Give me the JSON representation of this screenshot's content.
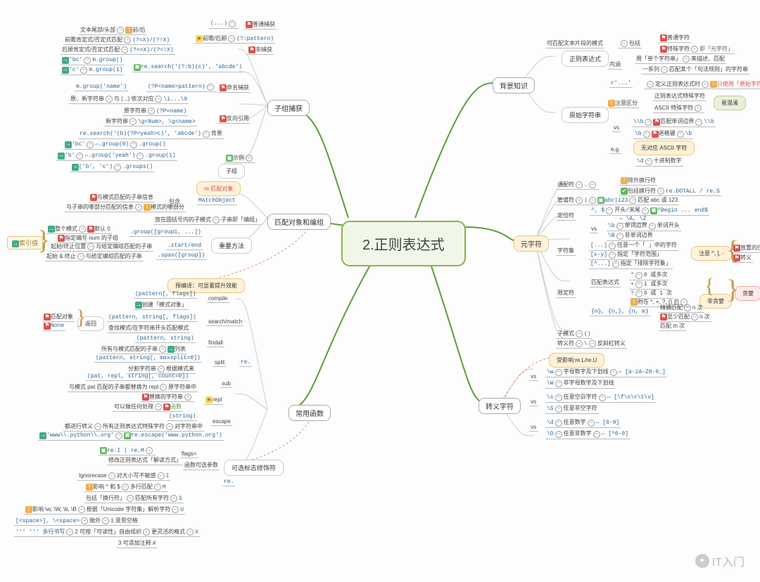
{
  "root": "2.正则表达式",
  "watermark": "IT入门",
  "branches": {
    "bg": "背景知识",
    "meta": "元字符",
    "escape": "转义字符",
    "func": "常用函数",
    "match": "匹配对象和编组",
    "group": "子组捕获"
  },
  "bg": {
    "regex": "正则表达式",
    "regex_def": "可匹配文本片段的模式",
    "contain": "包括",
    "plain": "普通字符",
    "special": "特殊字符",
    "aka": "即「元字符」",
    "inner": "内涵",
    "inner1a": "用「单个字符串」",
    "inner1b": "来描述、匹配",
    "inner2a": "一系列",
    "inner2b": "匹配某个「句法规则」的字符串",
    "raw": "原始字符串",
    "raw_r": "r'...'",
    "raw_def": "定义正则表达式时",
    "raw_use": "只使用「原始字符串」",
    "attn": "注意区分",
    "attn1": "正则表达式特殊字符",
    "attn2": "ASCII 特殊字符",
    "attn_tag": "易混淆",
    "vs": "vs",
    "vs1": "\\\\b",
    "vs1a": "匹配单词边界",
    "vs1b": "\\\\b",
    "vs2": "\\b",
    "vs2a": "退格键",
    "vs2b": "\\b",
    "eg": "e.g.",
    "no_ascii": "无对应 ASCII 字符",
    "eg1": "\\d",
    "eg1a": "十进制数字"
  },
  "meta": {
    "wildcard": "通配符",
    "wildcard_sym": ".",
    "wildcard_a": "除外换行符",
    "wildcard_b": "包括换行符",
    "wildcard_c": "re.DOTALL / re.S",
    "pipe": "管道符",
    "pipe_sym": "|",
    "pipe_eg": "abc|123",
    "pipe_def": "匹配 abc 或 123",
    "anchor": "定位符",
    "anchor1": "^, $",
    "anchor1a": "开头/末尾",
    "anchor1b": "^Begin ... end$",
    "anchor1c": "⇔ \\A, \\Z",
    "anchor2": "vs",
    "anchor2a": "\\b",
    "anchor2b": "单词边界",
    "anchor2c": "单词开头",
    "anchor2d": "\\B",
    "anchor2e": "非单词边界",
    "charset": "字符集",
    "cs1": "[...]",
    "cs1a": "任意一个「 」中的字符",
    "cs2": "[x-y]",
    "cs2a": "指定「字符范围」",
    "cs3": "[^...]",
    "cs3a": "指定「排除字符集」",
    "cs_note": "注意 ^, ], -",
    "cs_note1": "放置的位置",
    "cs_note2": "转义",
    "quant": "限定符",
    "q_def": "匹配表达式",
    "q1": "*",
    "q1a": "0 或多次",
    "q2": "+",
    "q2a": "1 或多次",
    "q3": "?",
    "q3a": "0 或 1 次",
    "q4": "附在 *, +, ?, {} 后",
    "q4a": "非贪婪",
    "q4b": "贪婪",
    "q5": "{n}, {n,}, {n, m}",
    "q5a": "精确匹配",
    "q5b": "n 次",
    "q5c": "至少匹配",
    "q5d": "n 次",
    "q5e": "匹配 m 次",
    "submode": "子模式",
    "submode_sym": "()",
    "escchar": "转义符",
    "escchar_sym": "\\",
    "escchar_def": "反斜杠转义"
  },
  "esc": {
    "title": "受影响:re.L/re.U",
    "w": "\\w",
    "w_def": "字母数字及下划线",
    "w_eq": "⇔ [a-zA-Z0-9_]",
    "W": "\\W",
    "W_def": "非字母数字及下划线",
    "s": "\\s",
    "s_def": "任意空白字符",
    "s_eq": "⇔ [\\f\\n\\r\\t\\v]",
    "S": "\\S",
    "S_def": "任意非空字符",
    "d": "\\d",
    "d_def": "任意数字",
    "d_eq": "⇔ [0-9]",
    "D": "\\D",
    "D_def": "任意非数字",
    "D_eq": "⇔ [^0-9]",
    "vs": "vs"
  },
  "func": {
    "precompile": "预编译：可显著提升效能",
    "compile": "compile",
    "compile1": "(pattern[, flags])",
    "compile2": "创建「模式对象」",
    "search": "search/match",
    "search1": "(pattern, string[, flags])",
    "search2": "查找模式/在字符串开头匹配模式",
    "ret": "返回",
    "ret1": "匹配对象",
    "ret2": "None",
    "findall": "findall",
    "findall1": "(pattern, string)",
    "findall2": "所有与模式匹配的子串",
    "findall3": "列表",
    "split": "split",
    "split1": "(pattern, string[, maxsplit=0])",
    "split2": "分割字符串",
    "split3": "根据模式来",
    "re_": "re.",
    "sub": "sub",
    "sub1": "(pat, repl, string[, count=0])",
    "sub2": "与模式 pat 匹配的子串都替换为 repl",
    "sub3": "原字符串中",
    "repl": "repl",
    "repl1": "替换的字符串",
    "repl2": "可以做任何处理",
    "repl3": "函数",
    "escape": "escape",
    "escape1": "(string)",
    "escape2": "都进行转义",
    "escape3": "所有正则表达式特殊字符",
    "escape4": "对字符串中",
    "escape5": "'www\\\\.python\\\\.org'",
    "escape6": "re.escape('www.python.org')",
    "flags": "可选标志修饰符",
    "flags_t": "flags=",
    "flags1": "re.I | re.M",
    "flags2": "函数可选参数",
    "flags3": "修改正则表达式「解读方式」",
    "I": "Ignorecase",
    "I1": "对大小写不敏感",
    "I2": "I",
    "M": "影响 ^ 和 $",
    "M1": "多行匹配",
    "M2": "M",
    "S": "包括「换行符」",
    "S1": "匹配所有字符",
    "S2": "S",
    "U": "影响 \\w, \\W, \\b, \\B",
    "U1": "根据「Unicode 字符集」解析字符",
    "U2": "U",
    "L": "[<space>], \\<space>",
    "L1": "做外",
    "L2": "1 意思空格",
    "X": "''' ''' 多行书写",
    "X1": "更灵活的格式",
    "X2": "X",
    "X3": "2 可按「可读性」自由组织",
    "X4": "3 可添加注释 #"
  },
  "match": {
    "title": "re 匹配对象",
    "obj": "MatchObject",
    "contain": "包含",
    "c1": "与模式匹配的子串信息",
    "c2": "与子串的哪部分匹配的信息",
    "c3": "模式的哪部分",
    "grp": ".group([group1, ...])",
    "grp1": "整个模式",
    "grp2": "默认 0",
    "grp3": "指定编号 num 的子组",
    "grp4": "放在圆括号内的子模式",
    "grp5": "子串即「编组」",
    "methods": "重要方法",
    "se": ".start/end",
    "se1": "起始/终止位置",
    "se2": "与给定编组匹配的子串",
    "span": ".span([group])",
    "span1": "起始 & 终止",
    "span2": "与给定编组匹配的子串",
    "idx": "索引值"
  },
  "grp": {
    "unnamed": "非捕获",
    "normal": "普通捕获",
    "normal1": "(...)",
    "look": "前瞻/后顾",
    "look1": "(?:pattern)",
    "named": "命名捕获",
    "named1": "(?P<name>pattern)",
    "back": "反向引用",
    "eg": "示例",
    "t1": "文本尾部/头部",
    "t1a": "前/后",
    "t2": "前瞻肯定式/否定式匹配",
    "t2a": "(?=X)/(?!X)",
    "t3": "后顾肯定式/否定式匹配",
    "t3a": "(?<=X)/(?<!X)",
    "bc": "'bc'",
    "bc1": "m.group()",
    "c": "'c'",
    "c1": "m.group(1)",
    "rs": "re.search('(?:b)(c)', 'abcde')",
    "mg": "m.group('name')",
    "orig": "原、新字符串",
    "orig1": "与 (...) 依次对应",
    "orig2": "\\1...\\9",
    "o2": "原字符串",
    "o2a": "(?P=name)",
    "o3": "新字符串",
    "o3a": "\\g<Num>, \\g<name>",
    "rs2": "re.search('(b)(?P<yeah>c)', 'abcde')",
    "bg_": "背景",
    "e1": "'bc'",
    "e1a": ".group(0)",
    "e1b": ".group()",
    "e2": "'b'",
    "e2a": ".group('yeah')",
    "e2b": ".group(1)",
    "e3": "('b', 'c')",
    "e3a": ".groups()",
    "groupt": "子组"
  }
}
